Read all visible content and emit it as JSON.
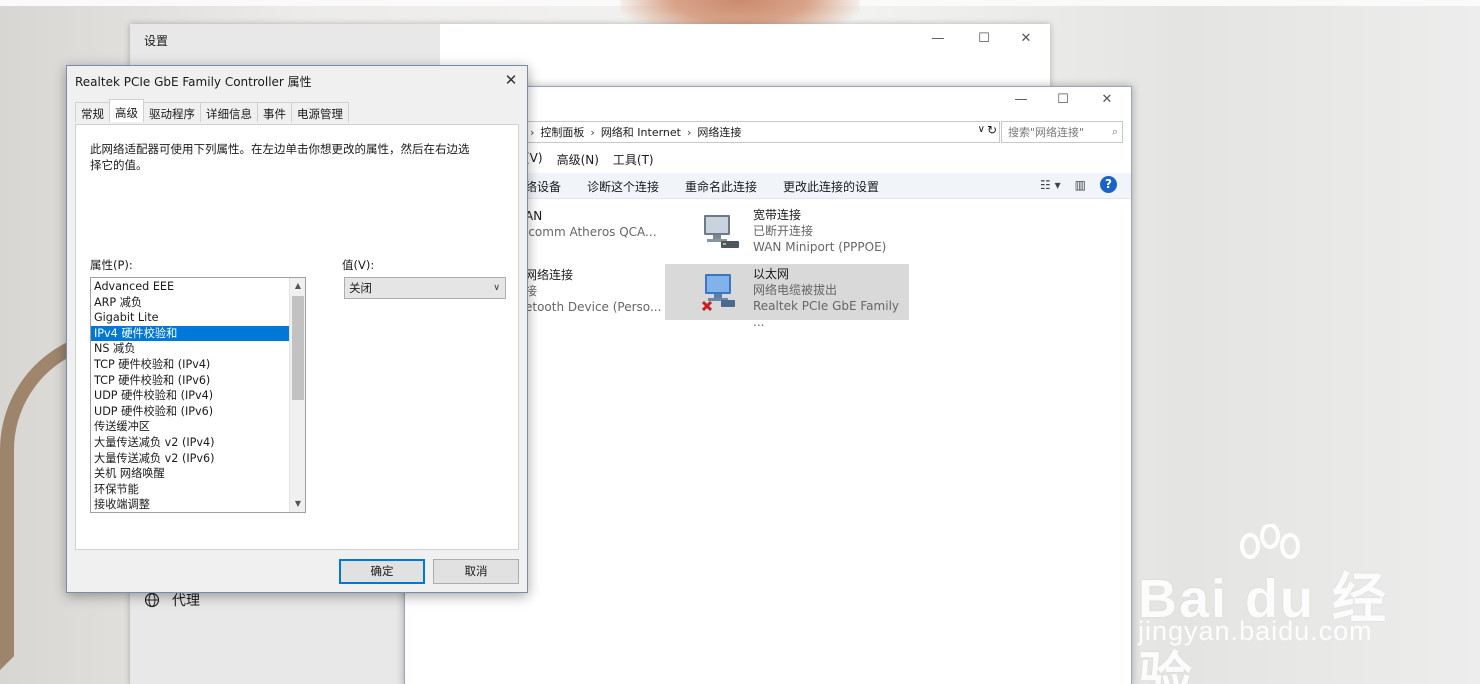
{
  "settings": {
    "title": "设置",
    "proxy_label": "代理"
  },
  "network": {
    "breadcrumb": [
      "控制面板",
      "网络和 Internet",
      "网络连接"
    ],
    "search_placeholder": "搜索\"网络连接\"",
    "menu": [
      "(V)",
      "高级(N)",
      "工具(T)"
    ],
    "commands": [
      "络设备",
      "诊断这个连接",
      "重命名此连接",
      "更改此连接的设置"
    ],
    "connections": [
      {
        "name": "AN",
        "status": "",
        "device": "lcomm Atheros QCA..."
      },
      {
        "name": "宽带连接",
        "status": "已断开连接",
        "device": "WAN Miniport (PPPOE)"
      },
      {
        "name": "网络连接",
        "status": "接",
        "device": "etooth Device (Perso..."
      },
      {
        "name": "以太网",
        "status": "网络电缆被拔出",
        "device": "Realtek PCIe GbE Family ..."
      }
    ]
  },
  "dialog": {
    "title": "Realtek PCIe GbE Family Controller 属性",
    "tabs": [
      "常规",
      "高级",
      "驱动程序",
      "详细信息",
      "事件",
      "电源管理"
    ],
    "description": "此网络适配器可使用下列属性。在左边单击你想更改的属性，然后在右边选择它的值。",
    "property_label": "属性(P):",
    "value_label": "值(V):",
    "properties": [
      "Advanced EEE",
      "ARP 减负",
      "Gigabit Lite",
      "IPv4 硬件校验和",
      "NS 减负",
      "TCP 硬件校验和 (IPv4)",
      "TCP 硬件校验和 (IPv6)",
      "UDP 硬件校验和 (IPv4)",
      "UDP 硬件校验和 (IPv6)",
      "传送缓冲区",
      "大量传送减负 v2 (IPv4)",
      "大量传送减负 v2 (IPv6)",
      "关机 网络唤醒",
      "环保节能",
      "接收端调整"
    ],
    "selected_value": "关闭",
    "ok_label": "确定",
    "cancel_label": "取消"
  },
  "watermark": {
    "brand": "Bai du 经验",
    "url": "jingyan.baidu.com"
  }
}
